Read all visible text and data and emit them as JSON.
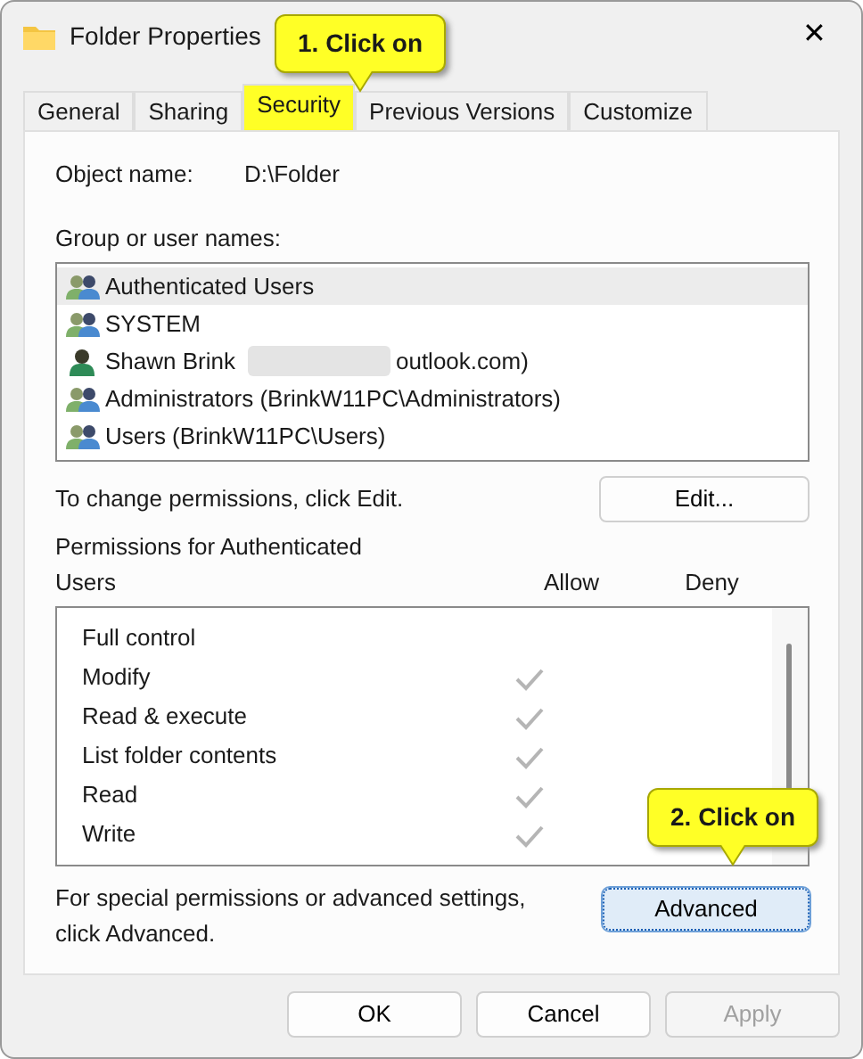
{
  "window": {
    "title": "Folder Properties",
    "close": "✕"
  },
  "tabs": [
    {
      "label": "General",
      "selected": false
    },
    {
      "label": "Sharing",
      "selected": false
    },
    {
      "label": "Security",
      "selected": true
    },
    {
      "label": "Previous Versions",
      "selected": false
    },
    {
      "label": "Customize",
      "selected": false
    }
  ],
  "object_name": {
    "label": "Object name:",
    "value": "D:\\Folder"
  },
  "groups": {
    "label": "Group or user names:",
    "items": [
      {
        "kind": "group",
        "name": "Authenticated Users",
        "selected": true
      },
      {
        "kind": "group",
        "name": "SYSTEM",
        "selected": false
      },
      {
        "kind": "user",
        "name": "Shawn Brink",
        "redacted_suffix": "outlook.com)",
        "selected": false
      },
      {
        "kind": "group",
        "name": "Administrators (BrinkW11PC\\Administrators)",
        "selected": false
      },
      {
        "kind": "group",
        "name": "Users (BrinkW11PC\\Users)",
        "selected": false
      }
    ]
  },
  "change_hint": "To change permissions, click Edit.",
  "edit_button": "Edit...",
  "permissions": {
    "label": "Permissions for Authenticated Users",
    "allow_header": "Allow",
    "deny_header": "Deny",
    "rows": [
      {
        "name": "Full control",
        "allow": false,
        "deny": false
      },
      {
        "name": "Modify",
        "allow": true,
        "deny": false
      },
      {
        "name": "Read & execute",
        "allow": true,
        "deny": false
      },
      {
        "name": "List folder contents",
        "allow": true,
        "deny": false
      },
      {
        "name": "Read",
        "allow": true,
        "deny": false
      },
      {
        "name": "Write",
        "allow": true,
        "deny": false
      }
    ]
  },
  "advanced_hint": "For special permissions or advanced settings, click Advanced.",
  "advanced_button": "Advanced",
  "callouts": [
    {
      "text": "1. Click on"
    },
    {
      "text": "2. Click on"
    }
  ],
  "buttons": [
    {
      "label": "OK",
      "disabled": false
    },
    {
      "label": "Cancel",
      "disabled": false
    },
    {
      "label": "Apply",
      "disabled": true
    }
  ]
}
